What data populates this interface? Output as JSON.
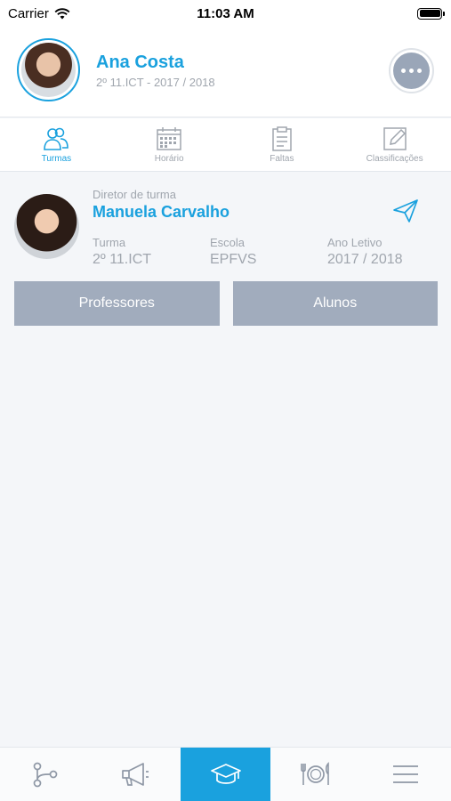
{
  "status_bar": {
    "carrier": "Carrier",
    "time": "11:03 AM"
  },
  "header": {
    "user_name": "Ana Costa",
    "user_subtitle": "2º 11.ICT - 2017 / 2018"
  },
  "tabs": [
    {
      "label": "Turmas",
      "icon": "people-icon",
      "active": true
    },
    {
      "label": "Horário",
      "icon": "calendar-icon",
      "active": false
    },
    {
      "label": "Faltas",
      "icon": "clipboard-icon",
      "active": false
    },
    {
      "label": "Classificações",
      "icon": "edit-icon",
      "active": false
    }
  ],
  "card": {
    "director_label": "Diretor de turma",
    "director_name": "Manuela Carvalho",
    "turma_label": "Turma",
    "turma_value": "2º 11.ICT",
    "escola_label": "Escola",
    "escola_value": "EPFVS",
    "ano_label": "Ano Letivo",
    "ano_value": "2017 / 2018"
  },
  "buttons": {
    "professores": "Professores",
    "alunos": "Alunos"
  },
  "bottom_nav": [
    {
      "icon": "share-icon",
      "active": false
    },
    {
      "icon": "megaphone-icon",
      "active": false
    },
    {
      "icon": "graduation-cap-icon",
      "active": true
    },
    {
      "icon": "plate-cutlery-icon",
      "active": false
    },
    {
      "icon": "menu-icon",
      "active": false
    }
  ],
  "colors": {
    "accent": "#1aa1de",
    "muted": "#a0a6ae",
    "button": "#a1acbd"
  }
}
